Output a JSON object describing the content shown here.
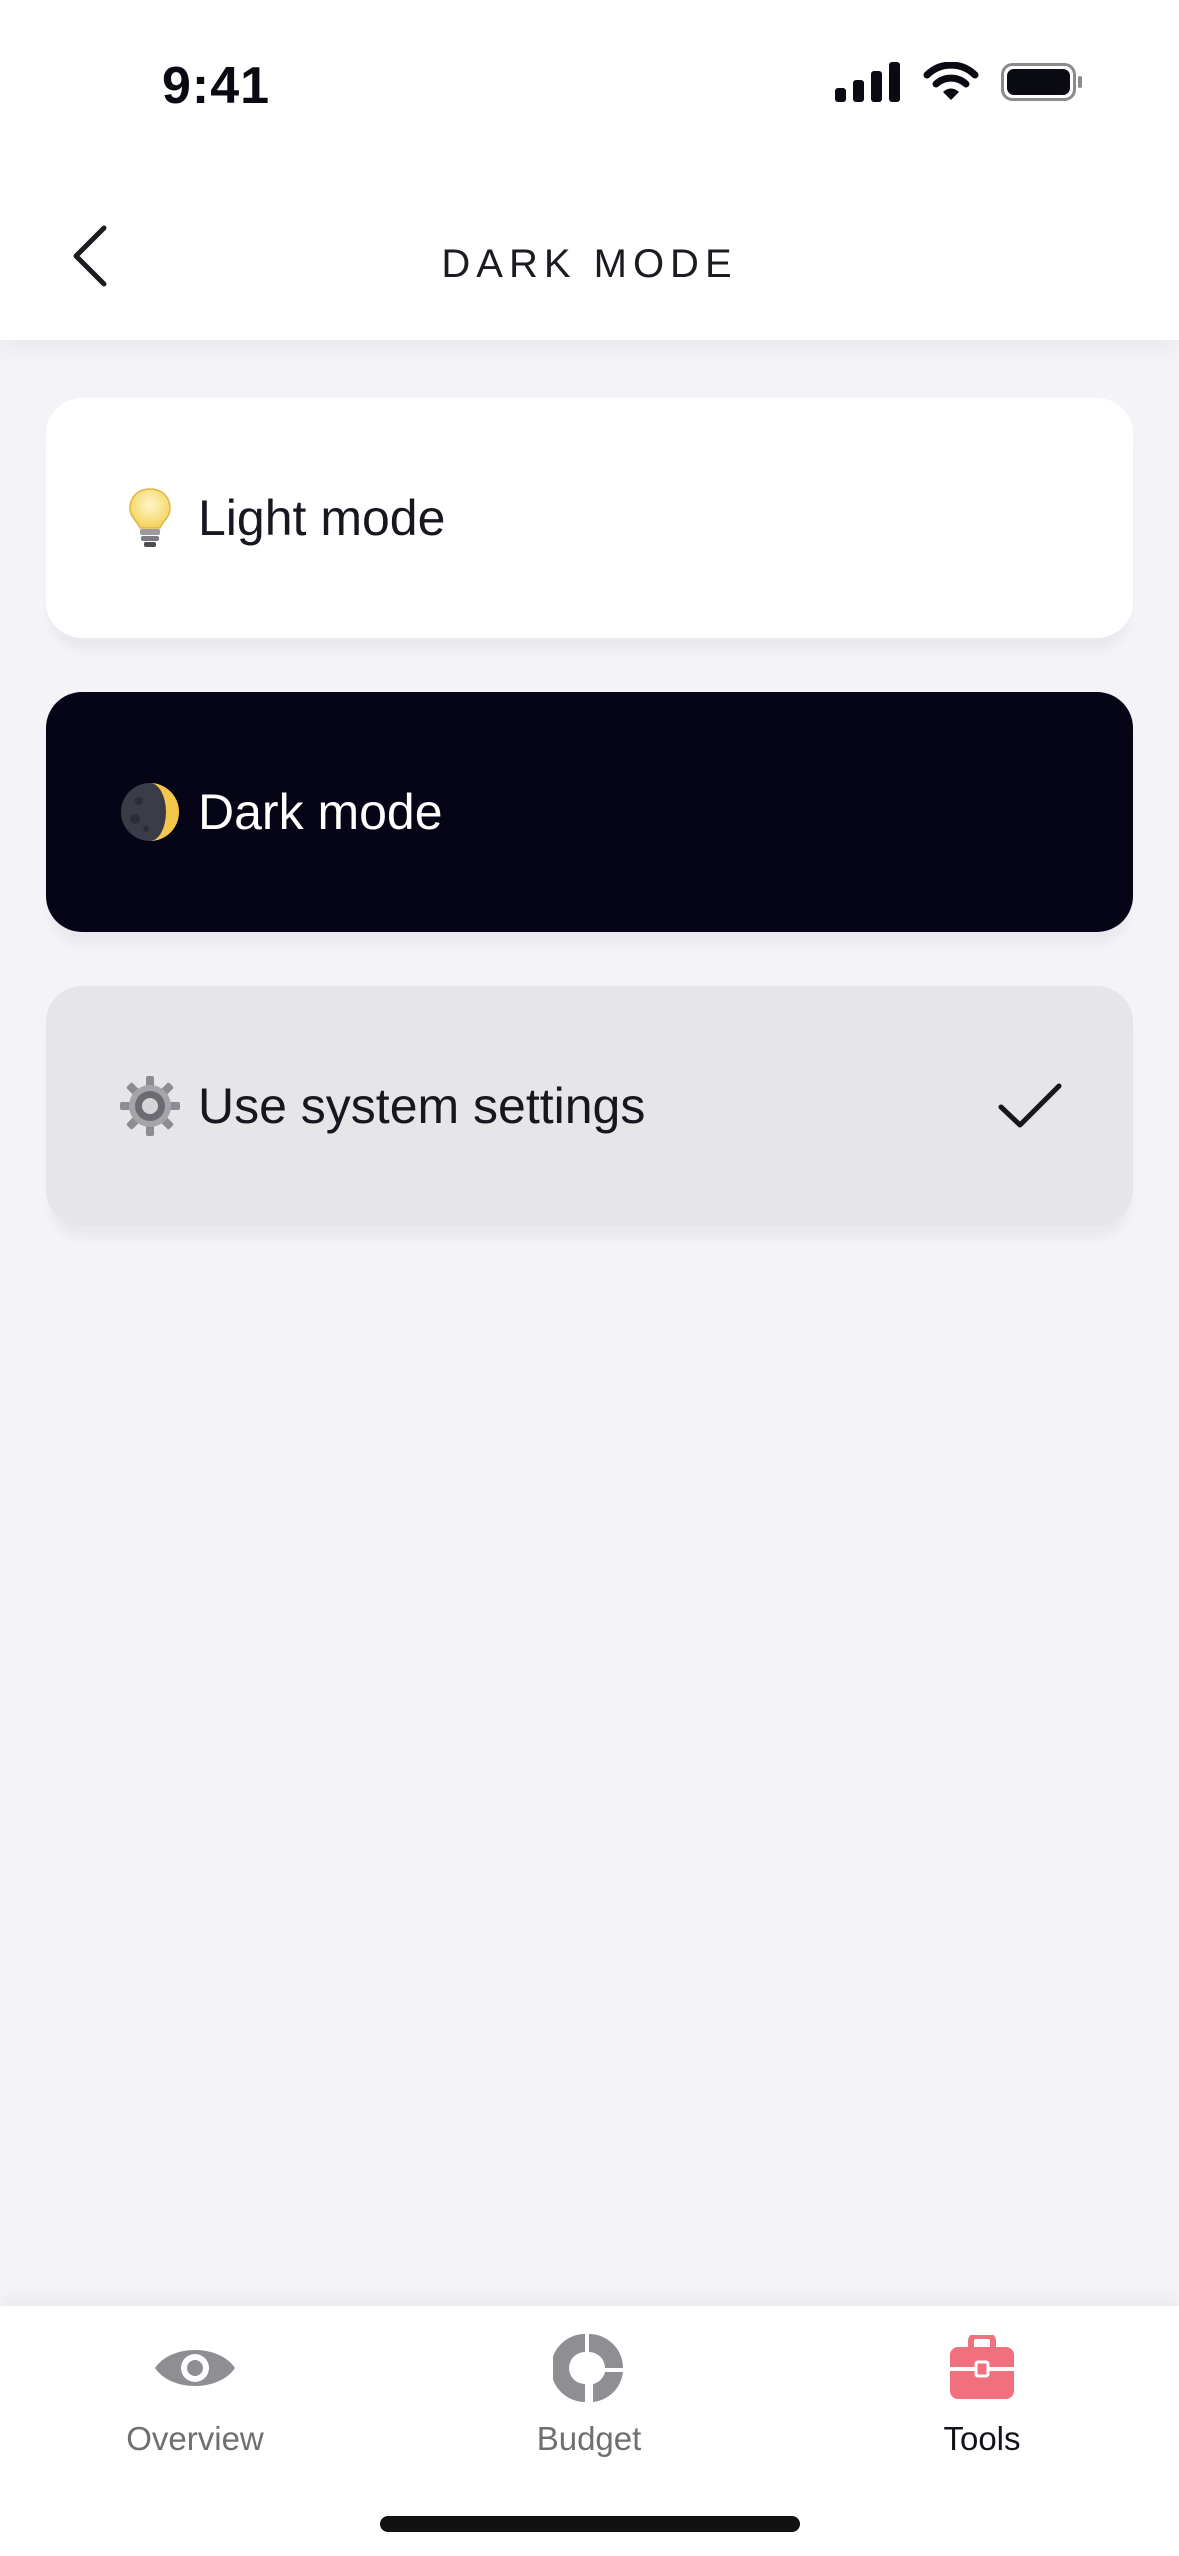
{
  "status_bar": {
    "time": "9:41",
    "icons": [
      "cellular-signal-icon",
      "wifi-icon",
      "battery-icon"
    ]
  },
  "nav": {
    "title": "DARK MODE",
    "back_icon": "chevron-left-icon"
  },
  "options": [
    {
      "label": "Light mode",
      "icon": "light-bulb-icon",
      "background": "#ffffff",
      "text_color": "#17171f",
      "selected": false
    },
    {
      "label": "Dark mode",
      "icon": "moon-icon",
      "background": "#050517",
      "text_color": "#ffffff",
      "selected": false
    },
    {
      "label": "Use system settings",
      "icon": "gear-icon",
      "background": "#e6e6e9",
      "text_color": "#17171f",
      "selected": true
    }
  ],
  "tabs": [
    {
      "label": "Overview",
      "icon": "eye-icon",
      "active": false
    },
    {
      "label": "Budget",
      "icon": "donut-chart-icon",
      "active": false
    },
    {
      "label": "Tools",
      "icon": "toolbox-icon",
      "active": true
    }
  ],
  "colors": {
    "page_background": "#f3f3f8",
    "accent_active_tab_icon": "#f0707e",
    "inactive_tab_icon": "#8e8e93",
    "dark_card": "#050517"
  }
}
